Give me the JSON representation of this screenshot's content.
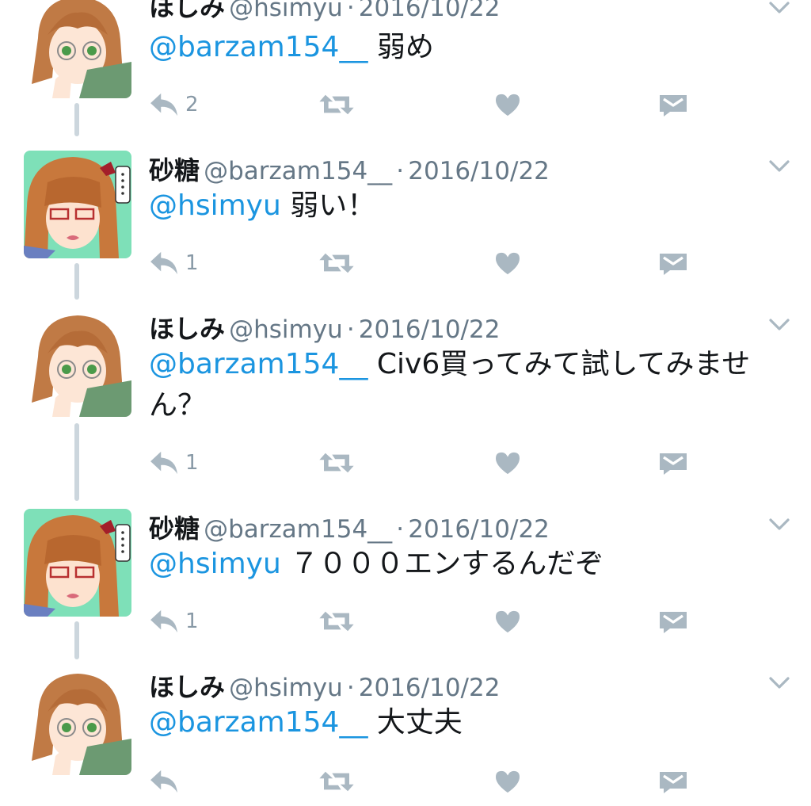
{
  "colors": {
    "mention": "#1b95e0",
    "meta": "#657786",
    "icon": "#aab8c2",
    "thread_line": "#ccd6dd"
  },
  "icons": [
    "reply-icon",
    "retweet-icon",
    "like-icon",
    "direct-message-icon",
    "chevron-down-icon"
  ],
  "tweets": [
    {
      "name": "ほしみ",
      "handle": "@hsimyu",
      "separator": "·",
      "date": "2016/10/22",
      "mention": "@barzam154__",
      "text": "弱め",
      "reply_count": "2"
    },
    {
      "name": "砂糖",
      "handle": "@barzam154__",
      "separator": "·",
      "date": "2016/10/22",
      "mention": "@hsimyu",
      "text": "弱い！",
      "reply_count": "1"
    },
    {
      "name": "ほしみ",
      "handle": "@hsimyu",
      "separator": "·",
      "date": "2016/10/22",
      "mention": "@barzam154__",
      "text": "Civ6買ってみて試してみません？",
      "reply_count": "1"
    },
    {
      "name": "砂糖",
      "handle": "@barzam154__",
      "separator": "·",
      "date": "2016/10/22",
      "mention": "@hsimyu",
      "text": "７０００エンするんだぞ",
      "reply_count": "1"
    },
    {
      "name": "ほしみ",
      "handle": "@hsimyu",
      "separator": "·",
      "date": "2016/10/22",
      "mention": "@barzam154__",
      "text": "大丈夫",
      "reply_count": ""
    }
  ]
}
